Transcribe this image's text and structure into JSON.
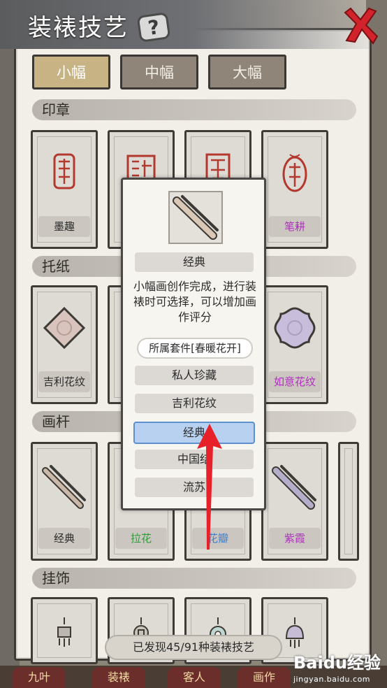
{
  "header": {
    "title": "装裱技艺",
    "help_glyph": "?"
  },
  "size_tabs": [
    {
      "label": "小幅",
      "selected": true
    },
    {
      "label": "中幅",
      "selected": false
    },
    {
      "label": "大幅",
      "selected": false
    }
  ],
  "sections": {
    "seal": {
      "title": "印章",
      "items": [
        {
          "label": "墨趣",
          "color": "#2b2b2b"
        },
        {
          "label": "",
          "color": "#2b2b2b"
        },
        {
          "label": "",
          "color": "#2b2b2b"
        },
        {
          "label": "笔耕",
          "color": "#b02fbf"
        }
      ]
    },
    "backing_paper": {
      "title": "托纸",
      "items": [
        {
          "label": "吉利花纹",
          "color": "#2b2b2b"
        },
        {
          "label": "",
          "color": "#2b2b2b"
        },
        {
          "label": "",
          "color": "#2b2b2b"
        },
        {
          "label": "如意花纹",
          "color": "#b02fbf"
        }
      ]
    },
    "rod": {
      "title": "画杆",
      "items": [
        {
          "label": "经典",
          "color": "#2b2b2b"
        },
        {
          "label": "拉花",
          "color": "#2f9a3a"
        },
        {
          "label": "花瓣",
          "color": "#3b7fcf"
        },
        {
          "label": "紫霞",
          "color": "#b02fbf"
        }
      ]
    },
    "pendant": {
      "title": "挂饰"
    }
  },
  "found_counter": "已发现45/91种装裱技艺",
  "bottom_menu": [
    "九叶",
    "装裱",
    "客人",
    "画作",
    ""
  ],
  "popup": {
    "name": "经典",
    "description": "小幅画创作完成，进行装裱时可选择，可以增加画作评分",
    "set": "所属套件[春暖花开]",
    "options": [
      {
        "label": "私人珍藏",
        "selected": false
      },
      {
        "label": "吉利花纹",
        "selected": false
      },
      {
        "label": "经典",
        "selected": true
      },
      {
        "label": "中国结",
        "selected": false
      },
      {
        "label": "流苏",
        "selected": false
      }
    ]
  },
  "watermark": {
    "brand": "Baidu经验",
    "url": "jingyan.baidu.com"
  },
  "colors": {
    "panel_bg": "#f2efe8",
    "selected_tab": "#c7b384",
    "selected_option": "#b9d1f0",
    "arrow": "#e8202a"
  }
}
